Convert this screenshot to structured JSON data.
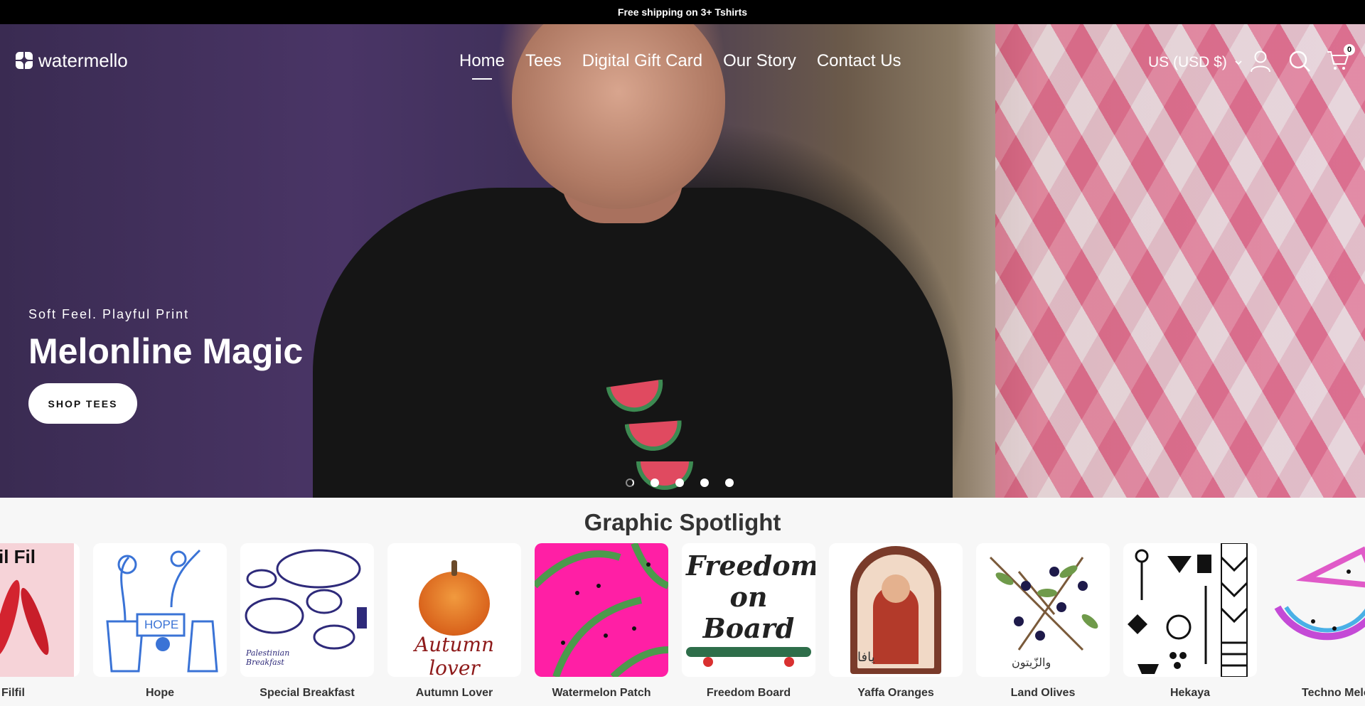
{
  "announcement": "Free shipping on 3+ Tshirts",
  "header": {
    "logo_text": "watermello",
    "nav": [
      "Home",
      "Tees",
      "Digital Gift Card",
      "Our Story",
      "Contact Us"
    ],
    "currency": "US (USD $)",
    "cart_count": "0"
  },
  "hero": {
    "subtitle": "Soft Feel. Playful Print",
    "title": "Melonline Magic",
    "cta": "SHOP TEES",
    "slides": 5,
    "active_slide": 1
  },
  "spotlight": {
    "title": "Graphic Spotlight",
    "items": [
      {
        "label": "Filfil",
        "art_text": "il Fil"
      },
      {
        "label": "Hope",
        "art_text": "HOPE"
      },
      {
        "label": "Special Breakfast",
        "art_text": "Palestinian Breakfast"
      },
      {
        "label": "Autumn Lover",
        "art_text": "Autumn lover"
      },
      {
        "label": "Watermelon Patch",
        "art_text": ""
      },
      {
        "label": "Freedom Board",
        "art_text": "Freedom on Board"
      },
      {
        "label": "Yaffa Oranges",
        "art_text": "يافا"
      },
      {
        "label": "Land Olives",
        "art_text": "والزّيتون"
      },
      {
        "label": "Hekaya",
        "art_text": ""
      },
      {
        "label": "Techno Melon",
        "art_text": ""
      }
    ]
  },
  "colors": {
    "announcement_bg": "#000000",
    "watermelon_pink": "#ff1fa5",
    "melon_green": "#3d8a52",
    "text_dark": "#333333"
  }
}
